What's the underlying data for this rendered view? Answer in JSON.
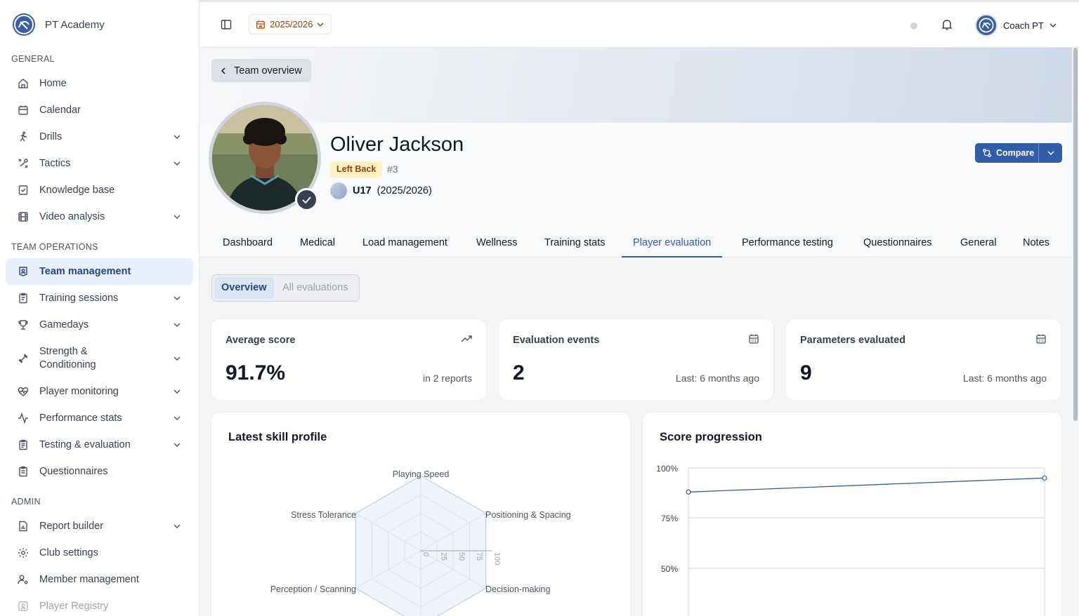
{
  "brand": {
    "name": "PT Academy"
  },
  "sidebar": {
    "sections": [
      {
        "title": "GENERAL"
      },
      {
        "title": "TEAM OPERATIONS"
      },
      {
        "title": "ADMIN"
      }
    ],
    "items": [
      {
        "label": "Home",
        "icon": "home-icon"
      },
      {
        "label": "Calendar",
        "icon": "calendar-icon"
      },
      {
        "label": "Drills",
        "icon": "running-icon"
      },
      {
        "label": "Tactics",
        "icon": "tactics-icon"
      },
      {
        "label": "Knowledge base",
        "icon": "book-icon"
      },
      {
        "label": "Video analysis",
        "icon": "film-icon"
      },
      {
        "label": "Team management",
        "icon": "team-icon"
      },
      {
        "label": "Training sessions",
        "icon": "clipboard-icon"
      },
      {
        "label": "Gamedays",
        "icon": "trophy-icon"
      },
      {
        "label": "Strength &\nConditioning",
        "icon": "dumbbell-icon"
      },
      {
        "label": "Player monitoring",
        "icon": "heart-pulse-icon"
      },
      {
        "label": "Performance stats",
        "icon": "activity-icon"
      },
      {
        "label": "Testing & evaluation",
        "icon": "clipboard-list-icon"
      },
      {
        "label": "Questionnaires",
        "icon": "clipboard-check-icon"
      },
      {
        "label": "Report builder",
        "icon": "report-icon"
      },
      {
        "label": "Club settings",
        "icon": "gear-icon"
      },
      {
        "label": "Member management",
        "icon": "user-cog-icon"
      },
      {
        "label": "Player Registry",
        "icon": "registry-icon"
      }
    ]
  },
  "topbar": {
    "season": "2025/2026",
    "user_name": "Coach PT"
  },
  "player": {
    "back_label": "Team overview",
    "name": "Oliver Jackson",
    "position": "Left Back",
    "jersey": "#3",
    "team": "U17",
    "team_season": "(2025/2026)",
    "compare_label": "Compare"
  },
  "tabs": [
    {
      "label": "Dashboard"
    },
    {
      "label": "Medical"
    },
    {
      "label": "Load management"
    },
    {
      "label": "Wellness"
    },
    {
      "label": "Training stats"
    },
    {
      "label": "Player evaluation"
    },
    {
      "label": "Performance testing"
    },
    {
      "label": "Questionnaires"
    },
    {
      "label": "General"
    },
    {
      "label": "Notes"
    }
  ],
  "active_tab": "Player evaluation",
  "segment": {
    "overview": "Overview",
    "all": "All evaluations"
  },
  "stats": [
    {
      "title": "Average score",
      "value": "91.7%",
      "sub": "in 2 reports",
      "icon": "trending-up-icon"
    },
    {
      "title": "Evaluation events",
      "value": "2",
      "sub": "Last: 6 months ago",
      "icon": "calendar-icon"
    },
    {
      "title": "Parameters evaluated",
      "value": "9",
      "sub": "Last: 6 months ago",
      "icon": "calendar-icon"
    }
  ],
  "skill_profile": {
    "title": "Latest skill profile",
    "axes": [
      "Playing Speed",
      "Positioning & Spacing",
      "Decision-making",
      "",
      "Perception / Scanning",
      "Stress Tolerance"
    ],
    "ticks": [
      "0",
      "25",
      "50",
      "75",
      "100"
    ]
  },
  "score_progression": {
    "title": "Score progression",
    "y_ticks": [
      "100%",
      "75%",
      "50%"
    ],
    "values": [
      88,
      95
    ]
  },
  "colors": {
    "accent": "#2f5cab",
    "active_nav_bg": "#eaf0fb",
    "badge_bg": "#fdf2c4"
  }
}
